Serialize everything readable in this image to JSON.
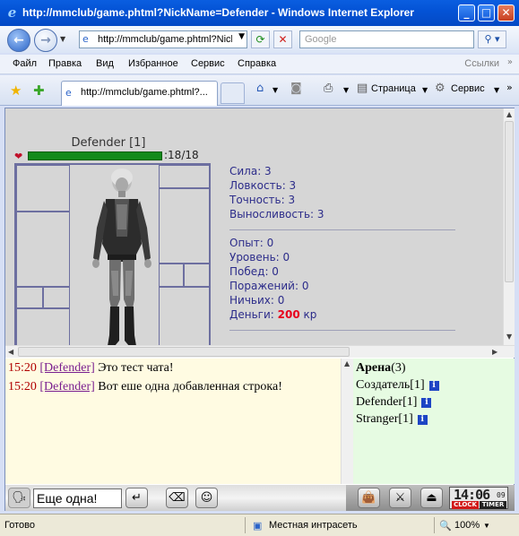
{
  "window": {
    "title": "http://mmclub/game.phtml?NickName=Defender - Windows Internet Explorer",
    "min_glyph": "_",
    "max_glyph": "□",
    "close_glyph": "✕"
  },
  "address": {
    "url": "http://mmclub/game.phtml?NickName=Defender",
    "search_placeholder": "Google"
  },
  "menu": {
    "items": [
      "Файл",
      "Правка",
      "Вид",
      "Избранное",
      "Сервис",
      "Справка"
    ],
    "links": "Ссылки"
  },
  "tabs": {
    "active_label": "http://mmclub/game.phtml?...",
    "page_menu": "Страница",
    "tools_menu": "Сервис"
  },
  "character": {
    "name": "Defender [1]",
    "hp_text": ":18/18",
    "hp_fraction": 1.0
  },
  "stats": {
    "sila": "Сила: 3",
    "lovkost": "Ловкость: 3",
    "tochnost": "Точность: 3",
    "vynoslivost": "Выносливость: 3",
    "opyt": "Опыт: 0",
    "uroven": "Уровень: 0",
    "pobed": "Побед: 0",
    "porazheniy": "Поражений: 0",
    "nichyih": "Ничьих: 0",
    "dengi_label": "Деньги:",
    "dengi_value": "200",
    "dengi_unit": "кр"
  },
  "chat": {
    "messages": [
      {
        "time": "15:20",
        "nick": "[Defender]",
        "text": " Это тест чата!"
      },
      {
        "time": "15:20",
        "nick": "[Defender]",
        "text": " Вот еше одна добавленная строка!"
      }
    ],
    "input_value": "Еще одна!"
  },
  "userlist": {
    "room_name": "Арена",
    "room_count": "(3)",
    "users": [
      "Создатель[1]",
      "Defender[1]",
      "Stranger[1]"
    ]
  },
  "clock": {
    "time": "14:06",
    "seconds": "09",
    "clock_label": "CLOCK",
    "timer_label": "TIMER"
  },
  "statusbar": {
    "status": "Готово",
    "zone": "Местная интрасеть",
    "zoom": "100%"
  },
  "colors": {
    "hp_bar": "#138a1b",
    "money": "#e8001c",
    "chat_bg": "#fffbe2",
    "userlist_bg": "#e6fbe2",
    "stats_text": "#2c2c8a"
  }
}
